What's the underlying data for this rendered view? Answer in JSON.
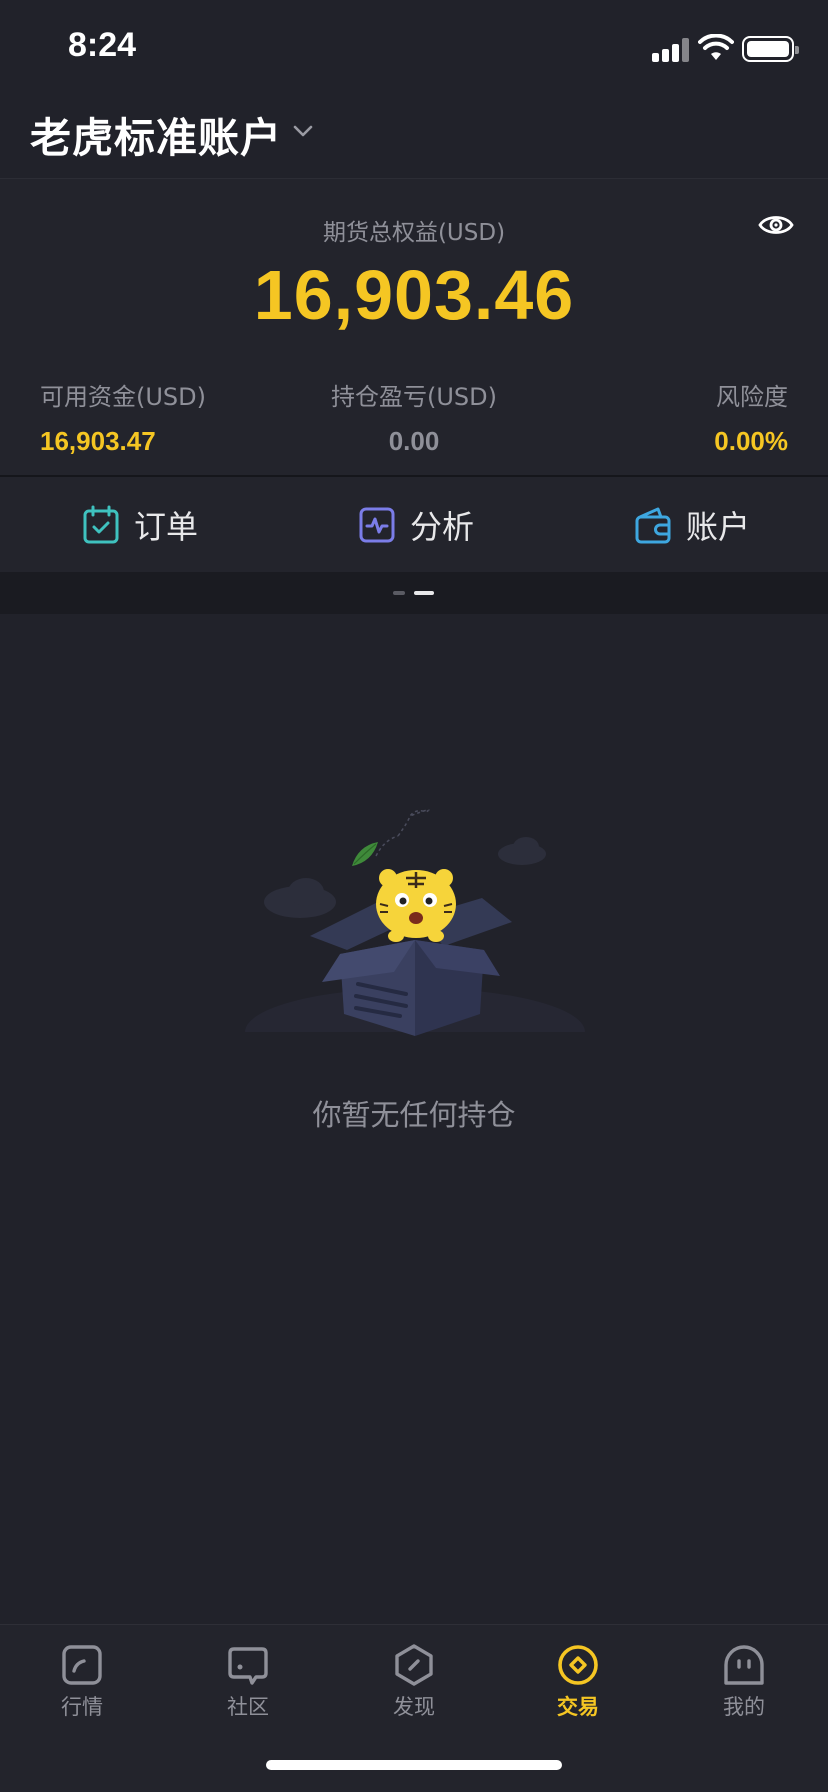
{
  "status": {
    "time": "8:24"
  },
  "account": {
    "title": "老虎标准账户"
  },
  "summary": {
    "equity_label": "期货总权益(USD)",
    "equity_value": "16,903.46",
    "metrics": [
      {
        "label": "可用资金(USD)",
        "value": "16,903.47"
      },
      {
        "label": "持仓盈亏(USD)",
        "value": "0.00"
      },
      {
        "label": "风险度",
        "value": "0.00%"
      }
    ]
  },
  "actions": [
    {
      "label": "订单",
      "icon": "calendar-check-icon",
      "color": "#3fc2bf"
    },
    {
      "label": "分析",
      "icon": "analysis-chart-icon",
      "color": "#7b7de8"
    },
    {
      "label": "账户",
      "icon": "wallet-icon",
      "color": "#3ea7e0"
    }
  ],
  "pager": {
    "total": 2,
    "active": 2
  },
  "empty_state": {
    "message": "你暂无任何持仓"
  },
  "tabs": [
    {
      "label": "行情",
      "icon": "market-icon",
      "active": false
    },
    {
      "label": "社区",
      "icon": "community-icon",
      "active": false
    },
    {
      "label": "发现",
      "icon": "discover-icon",
      "active": false
    },
    {
      "label": "交易",
      "icon": "trade-icon",
      "active": true
    },
    {
      "label": "我的",
      "icon": "profile-icon",
      "active": false
    }
  ],
  "colors": {
    "accent": "#f5c623",
    "background": "#21222a",
    "muted": "#8f9099"
  }
}
